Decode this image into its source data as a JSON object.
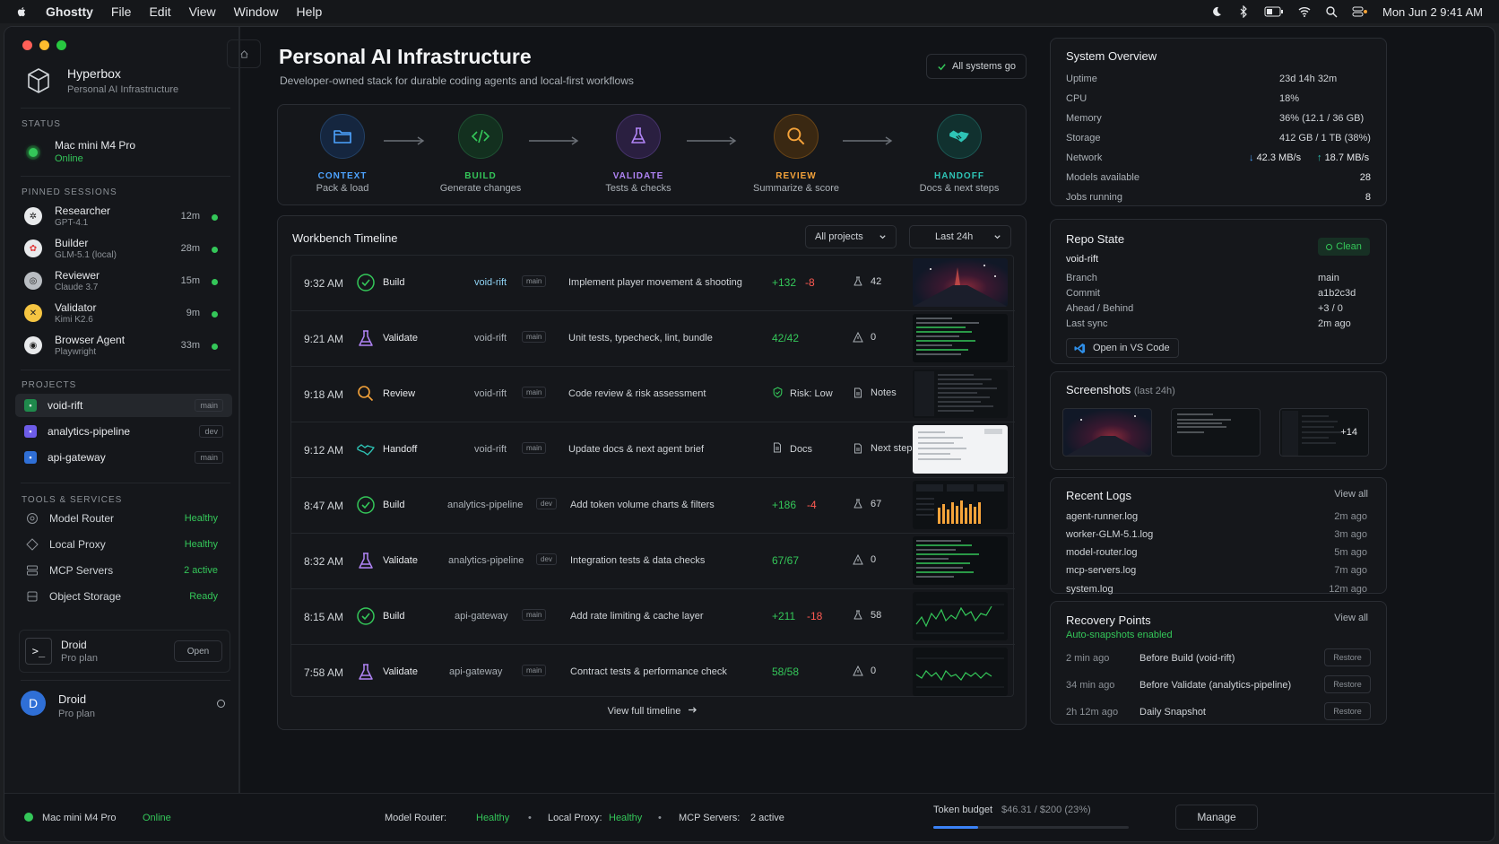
{
  "menubar": {
    "app": "Ghostty",
    "items": [
      "File",
      "Edit",
      "View",
      "Window",
      "Help"
    ],
    "datetime": "Mon Jun 2  9:41 AM"
  },
  "sidebar": {
    "brand": {
      "name": "Hyperbox",
      "sub": "Personal AI Infrastructure"
    },
    "status_label": "STATUS",
    "status": {
      "device": "Mac mini M4 Pro",
      "state": "Online"
    },
    "sessions_label": "PINNED SESSIONS",
    "sessions": [
      {
        "name": "Researcher",
        "model": "GPT-4.1",
        "time": "12m"
      },
      {
        "name": "Builder",
        "model": "GLM-5.1 (local)",
        "time": "28m"
      },
      {
        "name": "Reviewer",
        "model": "Claude 3.7",
        "time": "15m"
      },
      {
        "name": "Validator",
        "model": "Kimi K2.6",
        "time": "9m"
      },
      {
        "name": "Browser Agent",
        "model": "Playwright",
        "time": "33m"
      }
    ],
    "projects_label": "PROJECTS",
    "projects": [
      {
        "name": "void-rift",
        "branch": "main",
        "color": "#1f8a4c"
      },
      {
        "name": "analytics-pipeline",
        "branch": "dev",
        "color": "#6d5ce8"
      },
      {
        "name": "api-gateway",
        "branch": "main",
        "color": "#2f6fd6"
      }
    ],
    "tools_label": "TOOLS & SERVICES",
    "tools": [
      {
        "name": "Model Router",
        "status": "Healthy"
      },
      {
        "name": "Local Proxy",
        "status": "Healthy"
      },
      {
        "name": "MCP Servers",
        "status": "2 active"
      },
      {
        "name": "Object Storage",
        "status": "Ready"
      }
    ],
    "droid_app": {
      "name": "Droid",
      "plan": "Pro plan",
      "open": "Open"
    },
    "user": {
      "initial": "D",
      "name": "Droid",
      "plan": "Pro plan"
    }
  },
  "header": {
    "title": "Personal AI Infrastructure",
    "subtitle": "Developer-owned stack for durable coding agents and local-first workflows",
    "status": "All systems go"
  },
  "pipeline": [
    {
      "label": "CONTEXT",
      "desc": "Pack & load",
      "color": "#4da3ff"
    },
    {
      "label": "BUILD",
      "desc": "Generate changes",
      "color": "#34c759"
    },
    {
      "label": "VALIDATE",
      "desc": "Tests & checks",
      "color": "#b084f5"
    },
    {
      "label": "REVIEW",
      "desc": "Summarize & score",
      "color": "#f5a33a"
    },
    {
      "label": "HANDOFF",
      "desc": "Docs & next steps",
      "color": "#2ec4b6"
    }
  ],
  "timeline": {
    "title": "Workbench Timeline",
    "filter_projects": "All projects",
    "filter_time": "Last 24h",
    "rows": [
      {
        "time": "9:32 AM",
        "action": "Build",
        "repo": "void-rift",
        "branch": "main",
        "msg": "Implement player movement & shooting",
        "add": "+132",
        "del": "-8",
        "meta": "42"
      },
      {
        "time": "9:21 AM",
        "action": "Validate",
        "repo": "void-rift",
        "branch": "main",
        "msg": "Unit tests, typecheck, lint, bundle",
        "add": "42/42",
        "meta": "0"
      },
      {
        "time": "9:18 AM",
        "action": "Review",
        "repo": "void-rift",
        "branch": "main",
        "msg": "Code review & risk assessment",
        "risk": "Risk: Low",
        "notes": "Notes"
      },
      {
        "time": "9:12 AM",
        "action": "Handoff",
        "repo": "void-rift",
        "branch": "main",
        "msg": "Update docs & next agent brief",
        "docs": "Docs",
        "next": "Next steps"
      },
      {
        "time": "8:47 AM",
        "action": "Build",
        "repo": "analytics-pipeline",
        "branch": "dev",
        "msg": "Add token volume charts & filters",
        "add": "+186",
        "del": "-4",
        "meta": "67"
      },
      {
        "time": "8:32 AM",
        "action": "Validate",
        "repo": "analytics-pipeline",
        "branch": "dev",
        "msg": "Integration tests & data checks",
        "add": "67/67",
        "meta": "0"
      },
      {
        "time": "8:15 AM",
        "action": "Build",
        "repo": "api-gateway",
        "branch": "main",
        "msg": "Add rate limiting & cache layer",
        "add": "+211",
        "del": "-18",
        "meta": "58"
      },
      {
        "time": "7:58 AM",
        "action": "Validate",
        "repo": "api-gateway",
        "branch": "main",
        "msg": "Contract tests & performance check",
        "add": "58/58",
        "meta": "0"
      }
    ],
    "view_full": "View full timeline"
  },
  "system": {
    "title": "System Overview",
    "items": [
      {
        "k": "Uptime",
        "v": "23d 14h 32m"
      },
      {
        "k": "CPU",
        "v": "18%"
      },
      {
        "k": "Memory",
        "v": "36% (12.1 / 36 GB)"
      },
      {
        "k": "Storage",
        "v": "412 GB / 1 TB (38%)"
      }
    ],
    "network_label": "Network",
    "net_down": "42.3 MB/s",
    "net_up": "18.7 MB/s",
    "models_label": "Models available",
    "models": "28",
    "jobs_label": "Jobs running",
    "jobs": "8"
  },
  "repo": {
    "title": "Repo State",
    "name": "void-rift",
    "state": "Clean",
    "items": [
      {
        "k": "Branch",
        "v": "main"
      },
      {
        "k": "Commit",
        "v": "a1b2c3d"
      },
      {
        "k": "Ahead / Behind",
        "v": "+3 / 0"
      },
      {
        "k": "Last sync",
        "v": "2m ago"
      }
    ],
    "vscode": "Open in VS Code"
  },
  "screenshots": {
    "title": "Screenshots",
    "range": "(last 24h)",
    "more": "+14"
  },
  "logs": {
    "title": "Recent Logs",
    "view_all": "View all",
    "items": [
      {
        "name": "agent-runner.log",
        "ago": "2m ago"
      },
      {
        "name": "worker-GLM-5.1.log",
        "ago": "3m ago"
      },
      {
        "name": "model-router.log",
        "ago": "5m ago"
      },
      {
        "name": "mcp-servers.log",
        "ago": "7m ago"
      },
      {
        "name": "system.log",
        "ago": "12m ago"
      }
    ]
  },
  "recovery": {
    "title": "Recovery Points",
    "sub": "Auto-snapshots enabled",
    "view_all": "View all",
    "items": [
      {
        "ago": "2 min ago",
        "label": "Before Build (void-rift)",
        "btn": "Restore"
      },
      {
        "ago": "34 min ago",
        "label": "Before Validate (analytics-pipeline)",
        "btn": "Restore"
      },
      {
        "ago": "2h 12m ago",
        "label": "Daily Snapshot",
        "btn": "Restore"
      }
    ]
  },
  "statusbar": {
    "device": "Mac mini M4 Pro",
    "state": "Online",
    "router_label": "Model Router:",
    "router": "Healthy",
    "proxy_label": "Local Proxy:",
    "proxy": "Healthy",
    "mcp_label": "MCP Servers:",
    "mcp": "2 active",
    "token_label": "Token budget",
    "token_value": "$46.31 / $200 (23%)",
    "token_fraction": 0.23,
    "manage": "Manage"
  }
}
